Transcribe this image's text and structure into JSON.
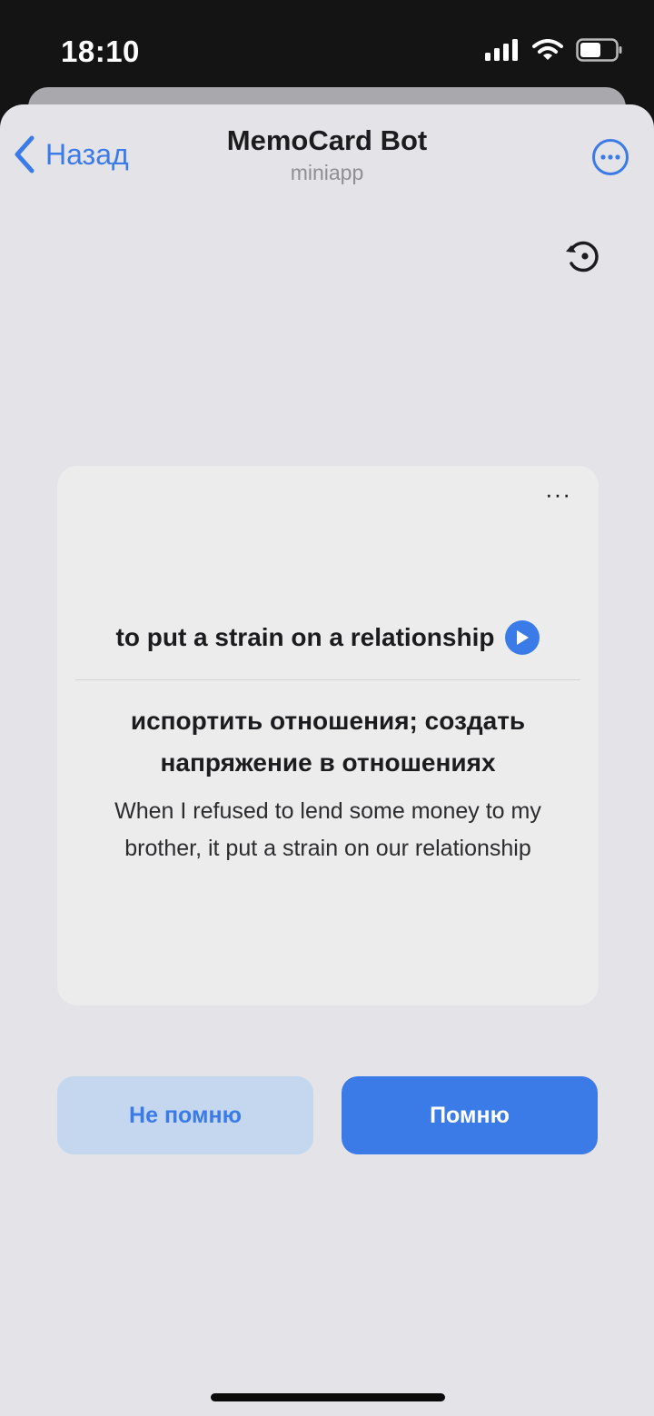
{
  "status_bar": {
    "time": "18:10"
  },
  "nav": {
    "back_label": "Назад",
    "title": "MemoCard Bot",
    "subtitle": "miniapp"
  },
  "card": {
    "menu": "···",
    "term": "to put a strain on a relationship",
    "translation": "испортить отношения; создать напряжение в отношениях",
    "example": "When I refused to lend some money to my brother, it put a strain on our relationship"
  },
  "actions": {
    "forgot_label": "Не помню",
    "remember_label": "Помню"
  },
  "icons": {
    "back": "chevron-left-icon",
    "more": "ellipsis-circle-icon",
    "reset": "history-reset-icon",
    "play": "play-icon",
    "signal": "signal-icon",
    "wifi": "wifi-icon",
    "battery": "battery-icon"
  },
  "colors": {
    "accent": "#3b7be8",
    "sheet_background": "#e3e3e8",
    "card_background": "#ececed",
    "secondary_button": "#c4d7ef"
  }
}
